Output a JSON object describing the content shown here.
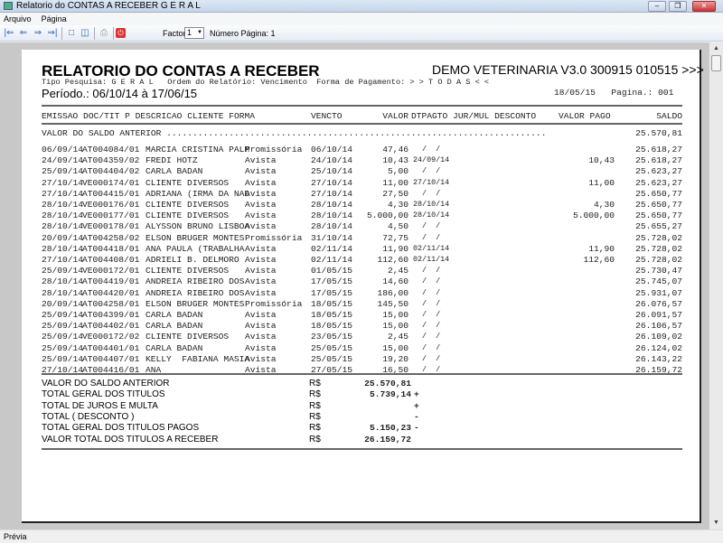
{
  "window": {
    "title": "Relatorio do CONTAS A RECEBER G E R A L"
  },
  "menu": [
    "Arquivo",
    "Página"
  ],
  "toolbar": {
    "factor_label": "Factor:",
    "factor_value": "1",
    "page_label": "Número Página: 1"
  },
  "report": {
    "title": "RELATORIO DO CONTAS A RECEBER",
    "company": "DEMO VETERINARIA V3.0 300915 010515 >>>",
    "filters": "Tipo Pesquisa: G E R A L   Ordem do Relatório: Vencimento  Forma de Pagamento: > > T O D A S < <",
    "period": "Período.: 06/10/14 à 17/06/15",
    "date_page": "18/05/15   Pagina.: 001",
    "headers": {
      "left": "EMISSAO DOC/TIT P DESCRICAO CLIENTE FORMA",
      "vencto": "VENCTO",
      "valor": "VALOR",
      "mid": "DTPAGTO JUR/MUL DESCONTO",
      "pago": "VALOR PAGO",
      "saldo": "SALDO"
    },
    "opening": {
      "label": "VALOR DO SALDO ANTERIOR .........................................................................",
      "saldo": "25.570,81"
    },
    "rows": [
      [
        "06/09/14",
        "AT004084/01",
        "MARCIA CRISTINA PALM",
        "Promissória",
        "06/10/14",
        "47,46",
        "  /  /",
        "",
        "25.618,27"
      ],
      [
        "24/09/14",
        "AT004359/02",
        "FREDI HOTZ",
        "Avista",
        "24/10/14",
        "10,43",
        "24/09/14",
        "10,43",
        "25.618,27"
      ],
      [
        "25/09/14",
        "AT004404/02",
        "CARLA BADAN",
        "Avista",
        "25/10/14",
        "5,00",
        "  /  /",
        "",
        "25.623,27"
      ],
      [
        "27/10/14",
        "VE000174/01",
        "CLIENTE DIVERSOS",
        "Avista",
        "27/10/14",
        "11,00",
        "27/10/14",
        "11,00",
        "25.623,27"
      ],
      [
        "27/10/14",
        "AT004415/01",
        "ADRIANA (IRMA DA NAD",
        "Avista",
        "27/10/14",
        "27,50",
        "  /  /",
        "",
        "25.650,77"
      ],
      [
        "28/10/14",
        "VE000176/01",
        "CLIENTE DIVERSOS",
        "Avista",
        "28/10/14",
        "4,30",
        "28/10/14",
        "4,30",
        "25.650,77"
      ],
      [
        "28/10/14",
        "VE000177/01",
        "CLIENTE DIVERSOS",
        "Avista",
        "28/10/14",
        "5.000,00",
        "28/10/14",
        "5.000,00",
        "25.650,77"
      ],
      [
        "28/10/14",
        "VE000178/01",
        "ALYSSON BRUNO LISBOA",
        "Avista",
        "28/10/14",
        "4,50",
        "  /  /",
        "",
        "25.655,27"
      ],
      [
        "20/09/14",
        "AT004258/02",
        "ELSON BRUGER MONTES",
        "Promissória",
        "31/10/14",
        "72,75",
        "  /  /",
        "",
        "25.728,02"
      ],
      [
        "28/10/14",
        "AT004418/01",
        "ANA PAULA (TRABALHA",
        "Avista",
        "02/11/14",
        "11,90",
        "02/11/14",
        "11,90",
        "25.728,02"
      ],
      [
        "27/10/14",
        "AT004408/01",
        "ADRIELI B. DELMORO",
        "Avista",
        "02/11/14",
        "112,60",
        "02/11/14",
        "112,60",
        "25.728,02"
      ],
      [
        "25/09/14",
        "VE000172/01",
        "CLIENTE DIVERSOS",
        "Avista",
        "01/05/15",
        "2,45",
        "  /  /",
        "",
        "25.730,47"
      ],
      [
        "28/10/14",
        "AT004419/01",
        "ANDREIA RIBEIRO DOS",
        "Avista",
        "17/05/15",
        "14,60",
        "  /  /",
        "",
        "25.745,07"
      ],
      [
        "28/10/14",
        "AT004420/01",
        "ANDREIA RIBEIRO DOS",
        "Avista",
        "17/05/15",
        "186,00",
        "  /  /",
        "",
        "25.931,07"
      ],
      [
        "20/09/14",
        "AT004258/01",
        "ELSON BRUGER MONTES",
        "Promissória",
        "18/05/15",
        "145,50",
        "  /  /",
        "",
        "26.076,57"
      ],
      [
        "25/09/14",
        "AT004399/01",
        "CARLA BADAN",
        "Avista",
        "18/05/15",
        "15,00",
        "  /  /",
        "",
        "26.091,57"
      ],
      [
        "25/09/14",
        "AT004402/01",
        "CARLA BADAN",
        "Avista",
        "18/05/15",
        "15,00",
        "  /  /",
        "",
        "26.106,57"
      ],
      [
        "25/09/14",
        "VE000172/02",
        "CLIENTE DIVERSOS",
        "Avista",
        "23/05/15",
        "2,45",
        "  /  /",
        "",
        "26.109,02"
      ],
      [
        "25/09/14",
        "AT004401/01",
        "CARLA BADAN",
        "Avista",
        "25/05/15",
        "15,00",
        "  /  /",
        "",
        "26.124,02"
      ],
      [
        "25/09/14",
        "AT004407/01",
        "KELLY  FABIANA MASIA",
        "Avista",
        "25/05/15",
        "19,20",
        "  /  /",
        "",
        "26.143,22"
      ],
      [
        "27/10/14",
        "AT004416/01",
        "ANA",
        "Avista",
        "27/05/15",
        "16,50",
        "  /  /",
        "",
        "26.159,72"
      ]
    ],
    "summary": [
      {
        "label": "VALOR DO SALDO ANTERIOR",
        "currency": "R$",
        "value": "25.570,81",
        "sign": ""
      },
      {
        "label": "TOTAL GERAL DOS TITULOS",
        "currency": "R$",
        "value": "5.739,14",
        "sign": "+"
      },
      {
        "label": "TOTAL DE JUROS E MULTA",
        "currency": "R$",
        "value": "",
        "sign": "+"
      },
      {
        "label": "TOTAL ( DESCONTO )",
        "currency": "R$",
        "value": "",
        "sign": "-"
      },
      {
        "label": "TOTAL GERAL DOS TITULOS PAGOS",
        "currency": "R$",
        "value": "5.150,23",
        "sign": "-"
      },
      {
        "label": "VALOR TOTAL DOS TITULOS A RECEBER",
        "currency": "R$",
        "value": "26.159,72",
        "sign": ""
      }
    ]
  },
  "status": {
    "text": "Prévia"
  }
}
